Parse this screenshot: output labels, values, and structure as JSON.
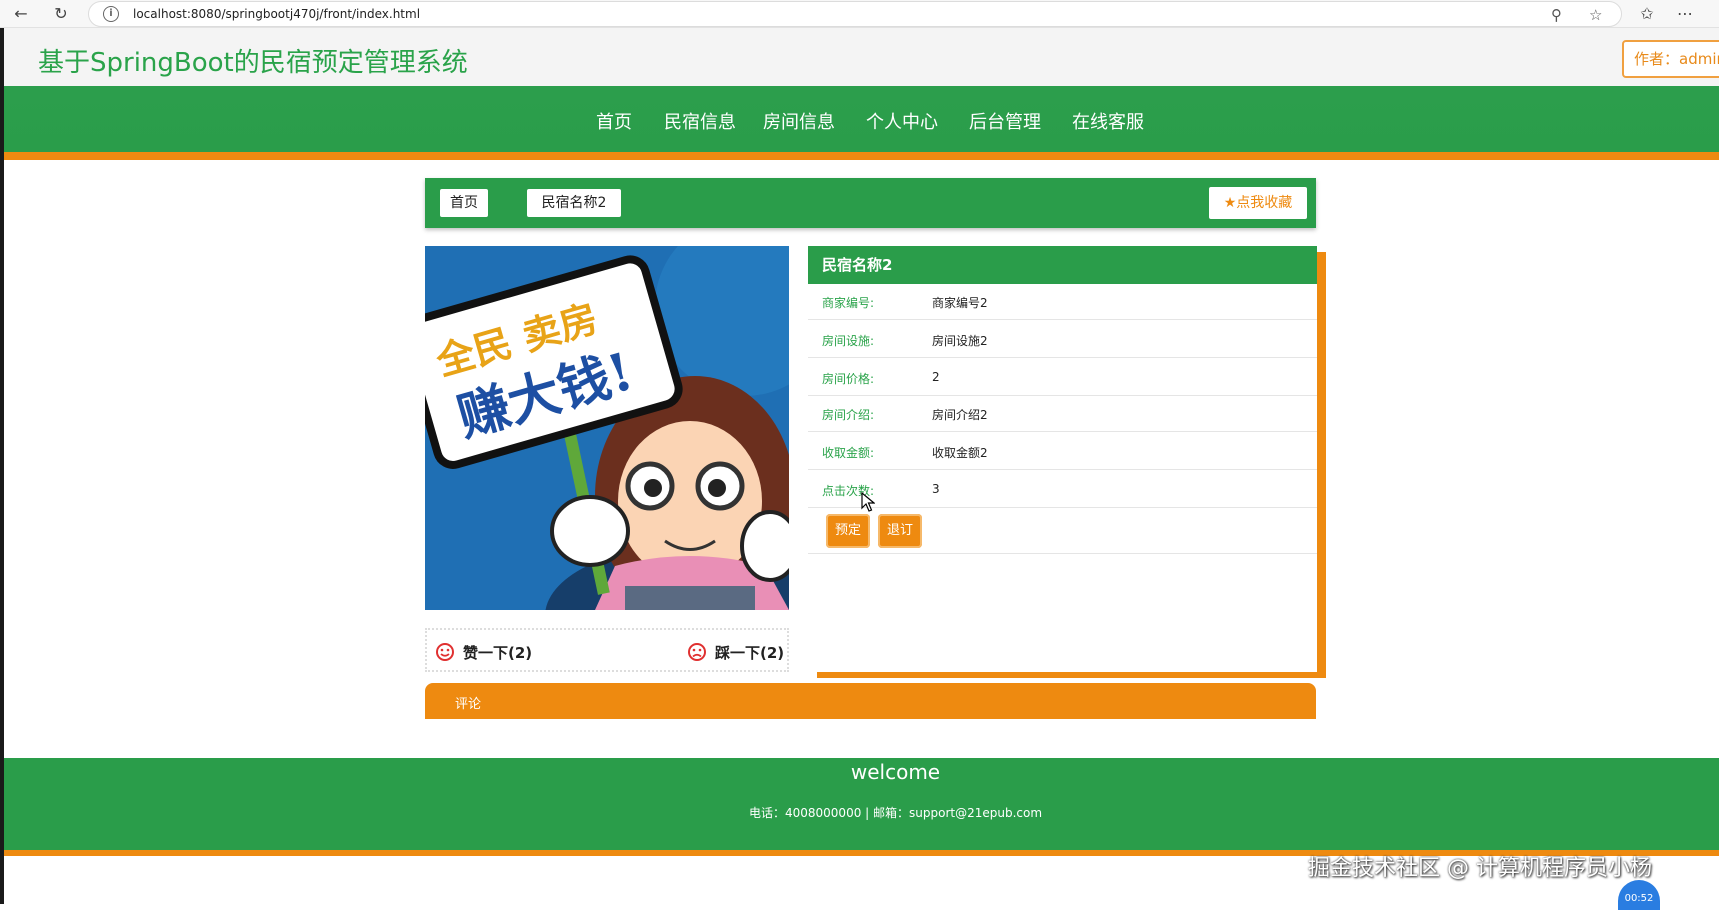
{
  "browser": {
    "url": "localhost:8080/springbootj470j/front/index.html"
  },
  "header": {
    "title": "基于SpringBoot的民宿预定管理系统",
    "author": "作者：admin"
  },
  "nav": {
    "items": [
      "首页",
      "民宿信息",
      "房间信息",
      "个人中心",
      "后台管理",
      "在线客服"
    ]
  },
  "breadcrumb": {
    "home": "首页",
    "current": "民宿名称2",
    "favorite": "点我收藏"
  },
  "votes": {
    "like": "赞一下(2)",
    "dislike": "踩一下(2)"
  },
  "detail": {
    "title": "民宿名称2",
    "rows": [
      {
        "label": "商家编号:",
        "value": "商家编号2"
      },
      {
        "label": "房间设施:",
        "value": "房间设施2"
      },
      {
        "label": "房间价格:",
        "value": "2"
      },
      {
        "label": "房间介绍:",
        "value": "房间介绍2"
      },
      {
        "label": "收取金额:",
        "value": "收取金额2"
      },
      {
        "label": "点击次数:",
        "value": "3"
      }
    ],
    "book_label": "预定",
    "cancel_label": "退订"
  },
  "image": {
    "sign_line1": "全民 卖房",
    "sign_line2": "赚大钱!"
  },
  "comment": {
    "label": "评论"
  },
  "footer": {
    "title": "welcome",
    "contact": "电话：4008000000 | 邮箱：support@21epub.com"
  },
  "overlay": {
    "watermark": "掘金技术社区 @ 计算机程序员小杨",
    "timer": "00:52"
  },
  "colors": {
    "green": "#2a9d4a",
    "orange": "#ee8a10"
  }
}
